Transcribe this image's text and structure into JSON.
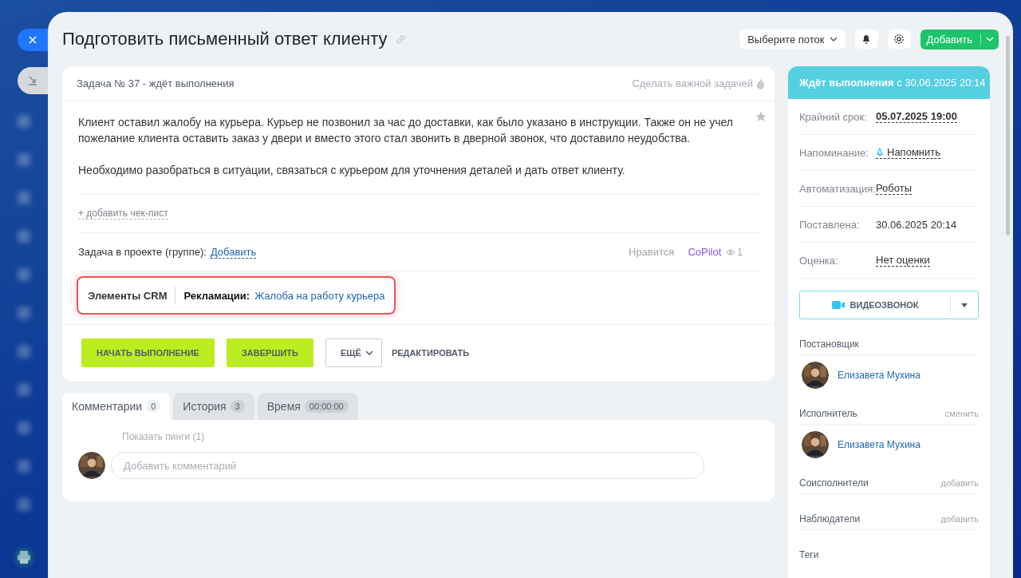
{
  "title": "Подготовить письменный ответ клиенту",
  "toolbar": {
    "flow_select": "Выберите поток",
    "add_button": "Добавить"
  },
  "task": {
    "header": "Задача № 37 - ждёт выполнения",
    "make_important": "Сделать важной задачей",
    "description": [
      "Клиент оставил жалобу на курьера. Курьер не позвонил за час до доставки, как было указано в инструкции. Также он не учел пожелание клиента оставить заказ у двери и вместо этого стал звонить в дверной звонок, что доставило неудобства.",
      "Необходимо разобраться в ситуации, связаться с курьером для уточнения деталей и дать ответ клиенту."
    ],
    "add_checklist": "+ добавить чек-лист",
    "project_label": "Задача в проекте (группе):",
    "project_link": "Добавить",
    "likes": "Нравится",
    "copilot": "CoPilot",
    "views": "1",
    "crm": {
      "label": "Элементы CRM",
      "type": "Рекламации:",
      "link": "Жалоба на работу курьера"
    },
    "buttons": [
      {
        "label": "НАЧАТЬ ВЫПОЛНЕНИЕ",
        "kind": "primary"
      },
      {
        "label": "ЗАВЕРШИТЬ",
        "kind": "primary"
      },
      {
        "label": "ЕЩЁ",
        "kind": "dropdown"
      },
      {
        "label": "РЕДАКТИРОВАТЬ",
        "kind": "text"
      }
    ]
  },
  "tabs": [
    {
      "label": "Комментарии",
      "count": "0",
      "selected": true
    },
    {
      "label": "История",
      "count": "3",
      "selected": false
    },
    {
      "label": "Время",
      "count": "00:00:00",
      "selected": false
    }
  ],
  "comments": {
    "show_pings": "Показать пинги (1)",
    "placeholder": "Добавить комментарий"
  },
  "sidebar": {
    "status": "**Ждёт выполнения** с 30.06.2025 20:14",
    "fields": [
      {
        "label": "Крайний срок:",
        "value": "05.07.2025 19:00",
        "kind": "bold-link"
      },
      {
        "label": "Напоминание:",
        "value": "Напомнить",
        "kind": "reminder"
      },
      {
        "label": "Автоматизация:",
        "value": "Роботы",
        "kind": "link"
      },
      {
        "label": "Поставлена:",
        "value": "30.06.2025 20:14",
        "kind": "plain"
      },
      {
        "label": "Оценка:",
        "value": "Нет оценки",
        "kind": "link"
      }
    ],
    "video_call": "ВИДЕОЗВОНОК",
    "roles": [
      {
        "title": "Постановщик",
        "people": [
          "Елизавета Мухина"
        ]
      },
      {
        "title": "Исполнитель",
        "action": "сменить",
        "people": [
          "Елизавета Мухина"
        ]
      },
      {
        "title": "Соисполнители",
        "action": "добавить"
      },
      {
        "title": "Наблюдатели",
        "action": "добавить"
      },
      {
        "title": "Теги"
      }
    ]
  }
}
